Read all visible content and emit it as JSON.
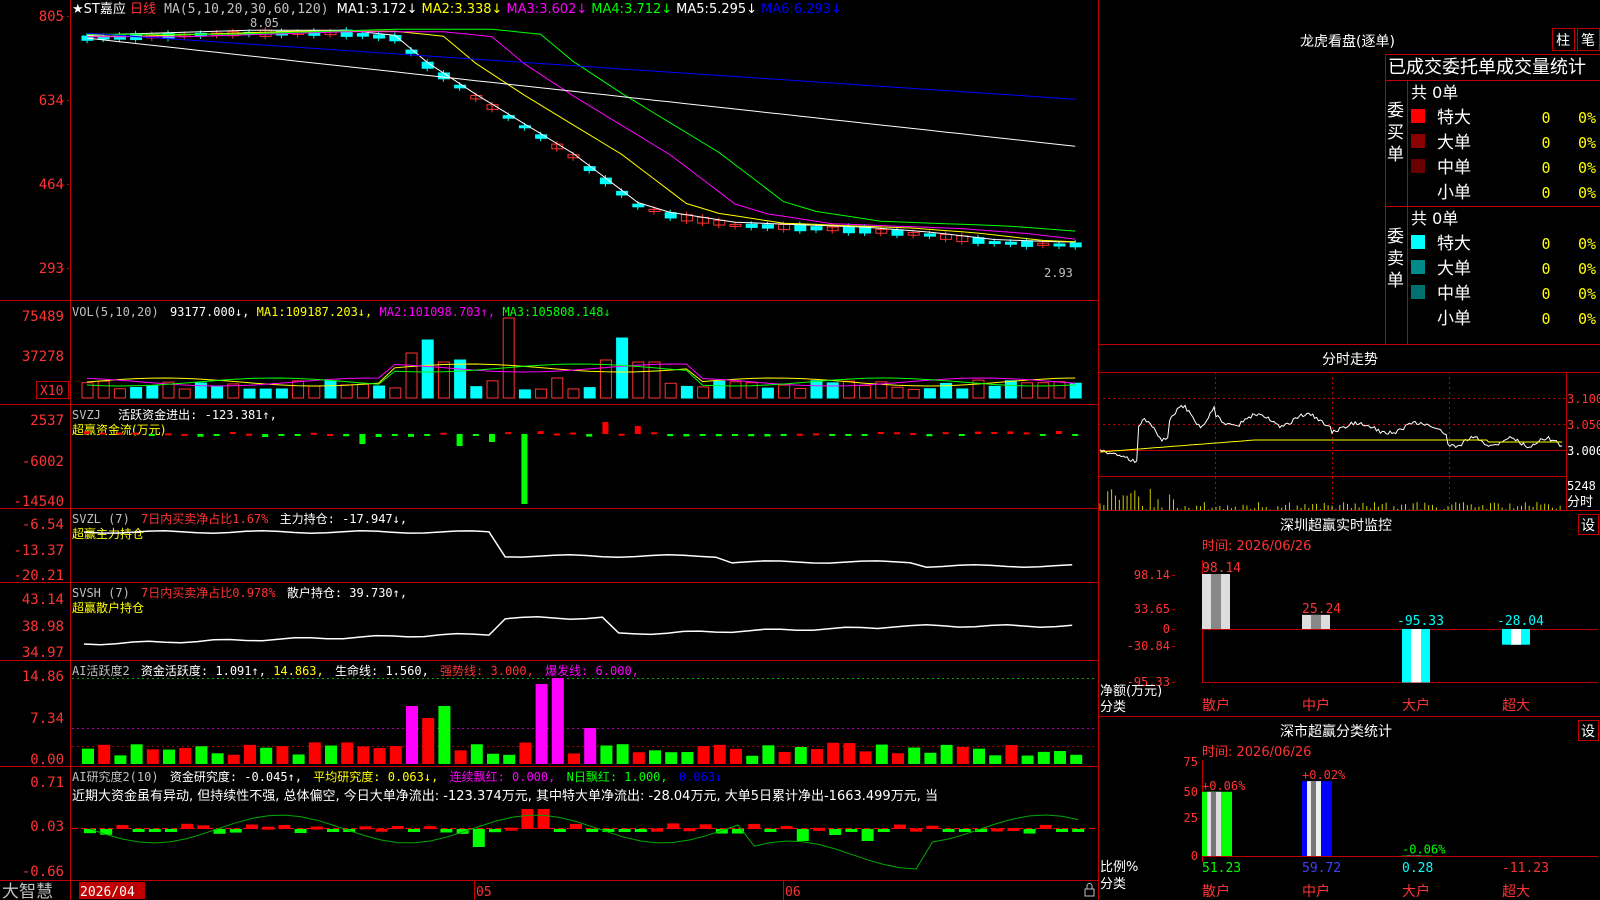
{
  "stock": {
    "name": "★ST嘉应",
    "period": "日线"
  },
  "app": {
    "name": "大智慧"
  },
  "price_panel": {
    "axis": [
      "805",
      "634",
      "464",
      "293"
    ],
    "header_ma": "MA(5,10,20,30,60,120)",
    "ma_values": [
      {
        "label": "MA1:",
        "value": "3.172↓",
        "color": "#ffffff"
      },
      {
        "label": "MA2:",
        "value": "3.338↓",
        "color": "#ffff00"
      },
      {
        "label": "MA3:",
        "value": "3.602↓",
        "color": "#ff00ff"
      },
      {
        "label": "MA4:",
        "value": "3.712↓",
        "color": "#00ff00"
      },
      {
        "label": "MA5:",
        "value": "5.295↓",
        "color": "#ffffff"
      },
      {
        "label": "MA6:",
        "value": "6.293↓",
        "color": "#0000ff"
      }
    ],
    "high_marker": "8.05",
    "low_marker": "2.93"
  },
  "vol_panel": {
    "axis": [
      "75489",
      "37278"
    ],
    "unit_btn": "X10",
    "header": "VOL(5,10,20)",
    "main_value": "93177.000↓,",
    "ma": [
      {
        "label": "MA1:",
        "value": "109187.203↓,",
        "color": "#ffff00"
      },
      {
        "label": "MA2:",
        "value": "101098.703↑,",
        "color": "#ff00ff"
      },
      {
        "label": "MA3:",
        "value": "105808.148↓",
        "color": "#00ff00"
      }
    ]
  },
  "svzj_panel": {
    "axis": [
      "2537",
      "-6002",
      "-14540"
    ],
    "header": "SVZJ",
    "item": "活跃资金进出: -123.381↑,",
    "subtitle": "超赢资金流(万元)"
  },
  "svzl_panel": {
    "axis": [
      "-6.54",
      "-13.37",
      "-20.21"
    ],
    "header": "SVZL (7)",
    "ratio": "7日内买卖净占比1.67%",
    "item": "主力持仓: -17.947↓,",
    "subtitle": "超赢主力持仓"
  },
  "svsh_panel": {
    "axis": [
      "43.14",
      "38.98",
      "34.97"
    ],
    "header": "SVSH (7)",
    "ratio": "7日内买卖净占比0.978%",
    "item": "散户持仓: 39.730↑,",
    "subtitle": "超赢散户持仓"
  },
  "ai_active_panel": {
    "axis": [
      "14.86",
      "7.34",
      "0.00"
    ],
    "header": "AI活跃度2",
    "item1": "资金活跃度: 1.091↑,",
    "item1b": "14.863,",
    "item2": "生命线: 1.560,",
    "item3": "强势线: 3.000,",
    "item4": "爆发线: 6.000,"
  },
  "ai_research_panel": {
    "axis": [
      "0.71",
      "0.03",
      "-0.66"
    ],
    "header": "AI研究度2(10)",
    "item1": "资金研究度: -0.045↑,",
    "item2": "平均研究度: 0.063↓,",
    "item3": "连续飘红: 0.000,",
    "item4": "N日飘红: 1.000,",
    "item5": "0.063↓",
    "comment": "近期大资金虽有异动, 但持续性不强, 总体偏空, 今日大单净流出: -123.374万元, 其中特大单净流出: -28.04万元, 大单5日累计净出-1663.499万元, 当"
  },
  "date_axis": {
    "labels": [
      "2026/04",
      "05",
      "06"
    ]
  },
  "lhkp": {
    "title": "龙虎看盘(逐单)",
    "btn1": "柱",
    "btn2": "笔",
    "table_title": "已成交委托单成交量统计",
    "buy_side": "委买单",
    "sell_side": "委卖单",
    "buy_total": "共 0单",
    "sell_total": "共 0单",
    "buy_rows": [
      {
        "name": "特大",
        "count": "0",
        "pct": "0%",
        "color": "#ff0000"
      },
      {
        "name": "大单",
        "count": "0",
        "pct": "0%",
        "color": "#8b0000"
      },
      {
        "name": "中单",
        "count": "0",
        "pct": "0%",
        "color": "#6b0000"
      },
      {
        "name": "小单",
        "count": "0",
        "pct": "0%",
        "color": ""
      }
    ],
    "sell_rows": [
      {
        "name": "特大",
        "count": "0",
        "pct": "0%",
        "color": "#00ffff"
      },
      {
        "name": "大单",
        "count": "0",
        "pct": "0%",
        "color": "#008b8b"
      },
      {
        "name": "中单",
        "count": "0",
        "pct": "0%",
        "color": "#007070"
      },
      {
        "name": "小单",
        "count": "0",
        "pct": "0%",
        "color": ""
      }
    ]
  },
  "intraday": {
    "title": "分时走势",
    "axis": [
      "3.100",
      "3.050",
      "3.000"
    ],
    "vol_value": "5248",
    "vol_label": "分时"
  },
  "sz_monitor": {
    "title": "深圳超赢实时监控",
    "btn": "设",
    "time": "时间: 2026/06/26",
    "axis": [
      "98.14",
      "33.65",
      "0",
      "-30.84",
      "-95.33"
    ],
    "y_label": "净额(万元)",
    "x_label": "分类",
    "categories": [
      "散户",
      "中户",
      "大户",
      "超大"
    ],
    "values": [
      "98.14",
      "25.24",
      "-95.33",
      "-28.04"
    ]
  },
  "sz_class": {
    "title": "深市超赢分类统计",
    "btn": "设",
    "time": "时间: 2026/06/26",
    "axis": [
      "75",
      "50",
      "25",
      "0"
    ],
    "y_label": "比例%",
    "x_label": "分类",
    "categories": [
      "散户",
      "中户",
      "大户",
      "超大"
    ],
    "top_labels": [
      "+0.06%",
      "+0.02%",
      "-0.06%",
      ""
    ],
    "bottom_values": [
      "51.23",
      "59.72",
      "0.28",
      "-11.23"
    ]
  }
}
